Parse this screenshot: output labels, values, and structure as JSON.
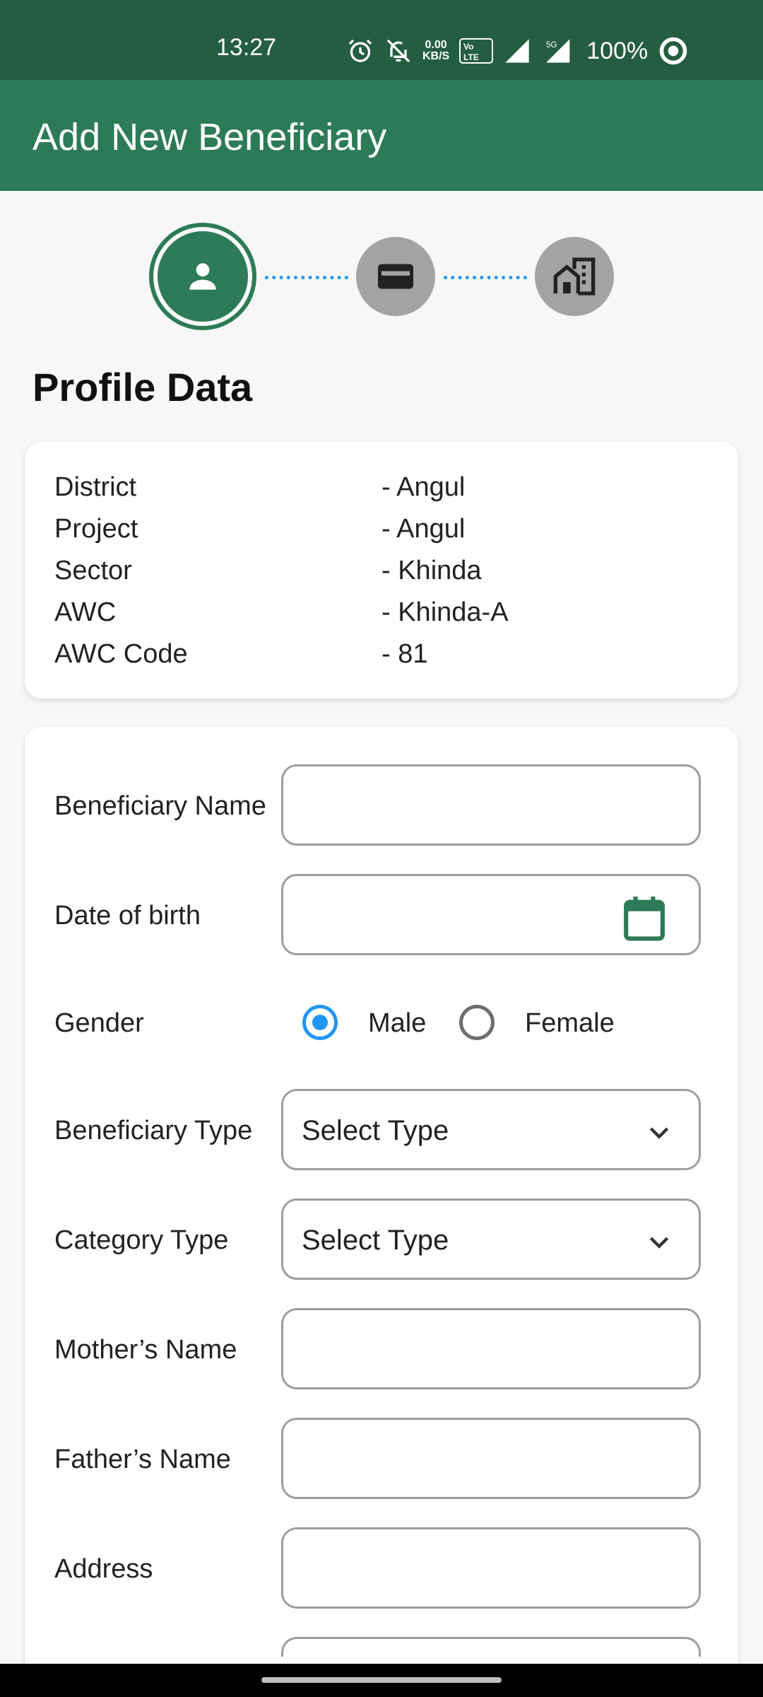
{
  "status": {
    "time": "13:27",
    "netspeed_value": "0.00",
    "netspeed_unit": "KB/S",
    "battery": "100%"
  },
  "app": {
    "title": "Add New Beneficiary"
  },
  "stepper": {
    "steps": [
      {
        "icon": "person-icon",
        "state": "active"
      },
      {
        "icon": "card-icon",
        "state": "inactive"
      },
      {
        "icon": "house-building-icon",
        "state": "inactive"
      }
    ]
  },
  "profile": {
    "title": "Profile Data",
    "rows": [
      {
        "label": "District",
        "value": "- Angul"
      },
      {
        "label": "Project",
        "value": "- Angul"
      },
      {
        "label": "Sector",
        "value": "- Khinda"
      },
      {
        "label": "AWC",
        "value": "- Khinda-A"
      },
      {
        "label": "AWC Code",
        "value": "- 81"
      }
    ]
  },
  "form": {
    "beneficiary_name": {
      "label": "Beneficiary Name",
      "value": ""
    },
    "dob": {
      "label": "Date of birth",
      "value": ""
    },
    "gender": {
      "label": "Gender",
      "options": [
        "Male",
        "Female"
      ],
      "selected": "Male"
    },
    "beneficiary_type": {
      "label": "Beneficiary Type",
      "value": "Select Type"
    },
    "category_type": {
      "label": "Category Type",
      "value": "Select Type"
    },
    "mother_name": {
      "label": "Mother’s Name",
      "value": ""
    },
    "father_name": {
      "label": "Father’s Name",
      "value": ""
    },
    "address": {
      "label": "Address",
      "value": ""
    }
  },
  "colors": {
    "status_bar": "#245d40",
    "app_bar": "#2d7b56",
    "radio_active": "#2196f3",
    "step_inactive": "#a3a3a3"
  }
}
